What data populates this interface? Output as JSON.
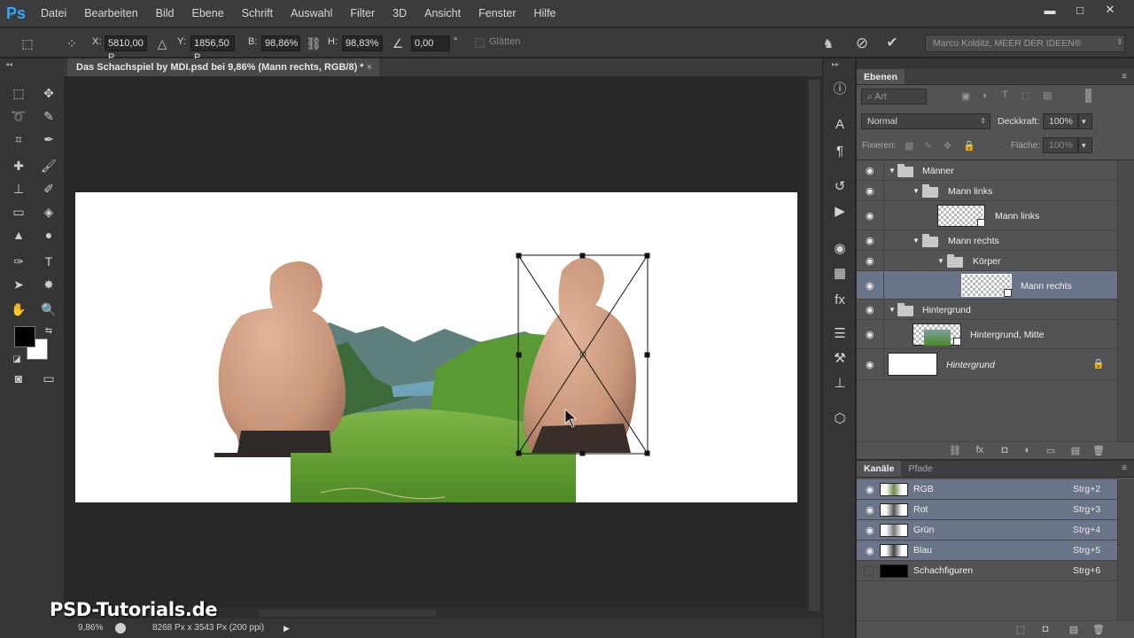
{
  "app": {
    "logo": "Ps"
  },
  "menu": [
    "Datei",
    "Bearbeiten",
    "Bild",
    "Ebene",
    "Schrift",
    "Auswahl",
    "Filter",
    "3D",
    "Ansicht",
    "Fenster",
    "Hilfe"
  ],
  "window_controls": {
    "minimize": "▬",
    "maximize": "□",
    "close": "✕"
  },
  "options": {
    "x_label": "X:",
    "x_value": "5810,00 P.",
    "y_label": "Y:",
    "y_value": "1856,50 P.",
    "b_label": "B:",
    "b_value": "98,86%",
    "h_label": "H:",
    "h_value": "98,83%",
    "angle_value": "0,00",
    "angle_unit": "°",
    "smooth_label": "Glätten",
    "workspace": "Marco Kolditz, MEER DER IDEEN®"
  },
  "document": {
    "tab_title": "Das Schachspiel by MDI.psd bei 9,86% (Mann rechts, RGB/8) *",
    "tab_close": "×",
    "zoom": "9,86%",
    "doc_size": "8268 Px x 3543 Px (200 ppi)"
  },
  "watermark": "PSD-Tutorials.de",
  "layers_panel": {
    "tab": "Ebenen",
    "filter_kind": "Art",
    "blend_mode": "Normal",
    "opacity_label": "Deckkraft:",
    "opacity_value": "100%",
    "lock_label": "Fixieren:",
    "fill_label": "Fläche:",
    "fill_value": "100%",
    "layers": [
      {
        "name": "Männer",
        "type": "group",
        "visible": true
      },
      {
        "name": "Mann links",
        "type": "group",
        "visible": true
      },
      {
        "name": "Mann links",
        "type": "smart-object",
        "visible": true
      },
      {
        "name": "Mann rechts",
        "type": "group",
        "visible": true
      },
      {
        "name": "Körper",
        "type": "group",
        "visible": true
      },
      {
        "name": "Mann rechts",
        "type": "smart-object",
        "visible": true,
        "selected": true
      },
      {
        "name": "Hintergrund",
        "type": "group",
        "visible": true
      },
      {
        "name": "Hintergrund, Mitte",
        "type": "smart-object",
        "visible": true
      },
      {
        "name": "Hintergrund",
        "type": "background",
        "visible": true,
        "locked": true
      }
    ]
  },
  "channels_panel": {
    "tabs": [
      "Kanäle",
      "Pfade"
    ],
    "channels": [
      {
        "name": "RGB",
        "shortcut": "Strg+2",
        "visible": true,
        "selected": true
      },
      {
        "name": "Rot",
        "shortcut": "Strg+3",
        "visible": true,
        "selected": true
      },
      {
        "name": "Grün",
        "shortcut": "Strg+4",
        "visible": true,
        "selected": true
      },
      {
        "name": "Blau",
        "shortcut": "Strg+5",
        "visible": true,
        "selected": true
      },
      {
        "name": "Schachfiguren",
        "shortcut": "Strg+6",
        "visible": false,
        "selected": false
      }
    ]
  },
  "colors": {
    "accent_ps": "#31a8ff",
    "selection": "#6a7488",
    "foreground_swatch": "#000000",
    "background_swatch": "#ffffff"
  }
}
